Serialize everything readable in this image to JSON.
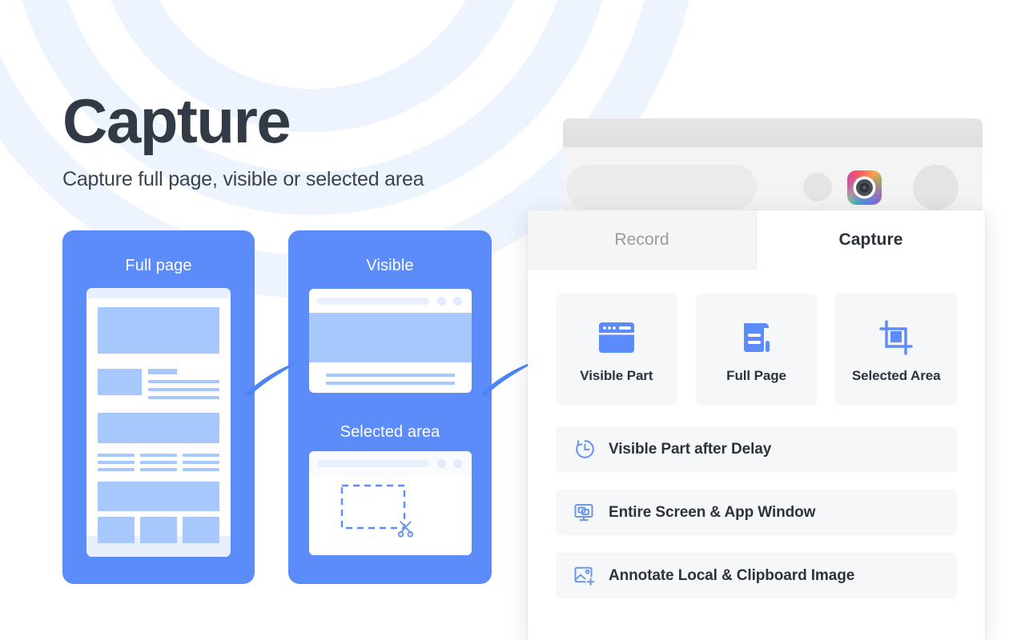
{
  "page": {
    "title": "Capture",
    "subtitle": "Capture full page, visible or selected area",
    "accent_blue": "#5b8cfa",
    "light_blue": "#a6c8fd",
    "pale_blue": "#e8f0fe",
    "text_dark": "#2c333d",
    "panel_gray": "#f6f7f8"
  },
  "illustration": {
    "cards": [
      {
        "label": "Full page"
      },
      {
        "label": "Visible"
      },
      {
        "label": "Selected area"
      }
    ],
    "fullpage_label": "Full page",
    "visible_label": "Visible",
    "selected_label": "Selected area",
    "scissors_icon": "scissors-icon"
  },
  "browser": {
    "extension_icon": "capture-extension-icon"
  },
  "popup": {
    "tabs": [
      {
        "label": "Record",
        "active": false
      },
      {
        "label": "Capture",
        "active": true
      }
    ],
    "tab_record": "Record",
    "tab_capture": "Capture",
    "tiles": [
      {
        "label": "Visible Part",
        "icon": "browser-window-icon"
      },
      {
        "label": "Full Page",
        "icon": "scroll-document-icon"
      },
      {
        "label": "Selected Area",
        "icon": "crop-icon"
      }
    ],
    "list": [
      {
        "label": "Visible Part after Delay",
        "icon": "clock-delay-icon"
      },
      {
        "label": "Entire Screen & App Window",
        "icon": "monitor-windows-icon"
      },
      {
        "label": "Annotate Local & Clipboard Image",
        "icon": "image-plus-icon"
      }
    ]
  }
}
